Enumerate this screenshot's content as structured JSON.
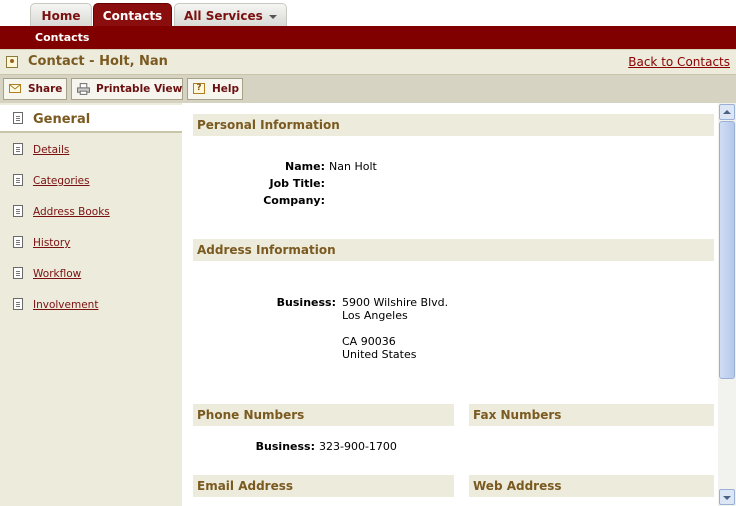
{
  "tabs": [
    {
      "label": "Home"
    },
    {
      "label": "Contacts"
    },
    {
      "label": "All Services"
    }
  ],
  "subnav": {
    "label": "Contacts"
  },
  "titlebar": {
    "title": "Contact - Holt, Nan",
    "back_link": "Back to Contacts"
  },
  "toolbar": {
    "share": "Share",
    "printable": "Printable View",
    "help": "Help",
    "help_glyph": "?"
  },
  "sidebar": {
    "active": "General",
    "items": [
      {
        "label": "Details"
      },
      {
        "label": "Categories"
      },
      {
        "label": "Address Books"
      },
      {
        "label": "History"
      },
      {
        "label": "Workflow"
      },
      {
        "label": "Involvement"
      }
    ]
  },
  "personal": {
    "heading": "Personal Information",
    "name_label": "Name:",
    "name_value": "Nan Holt",
    "job_label": "Job Title:",
    "job_value": "",
    "company_label": "Company:",
    "company_value": ""
  },
  "address": {
    "heading": "Address Information",
    "business_label": "Business:",
    "line1": "5900 Wilshire Blvd.",
    "line2": "Los Angeles",
    "line3": "CA 90036",
    "line4": "United States"
  },
  "phone": {
    "heading": "Phone Numbers",
    "business_label": "Business:",
    "business_value": "323-900-1700"
  },
  "fax": {
    "heading": "Fax Numbers"
  },
  "email": {
    "heading": "Email Address"
  },
  "web": {
    "heading": "Web Address"
  },
  "colors": {
    "brand": "#800000",
    "panel": "#ecebdc",
    "heading_text": "#7a5a20",
    "link": "#7a1010"
  }
}
